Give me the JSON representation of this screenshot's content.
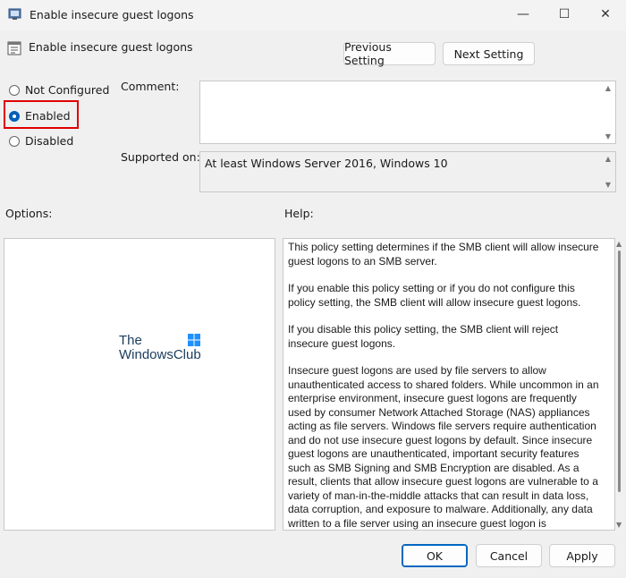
{
  "window": {
    "title": "Enable insecure guest logons",
    "heading": "Enable insecure guest logons",
    "controls": {
      "minimize": "—",
      "maximize": "☐",
      "close": "✕"
    }
  },
  "nav": {
    "previous": "Previous Setting",
    "next": "Next Setting"
  },
  "state": {
    "options": [
      {
        "label": "Not Configured",
        "checked": false
      },
      {
        "label": "Enabled",
        "checked": true
      },
      {
        "label": "Disabled",
        "checked": false
      }
    ]
  },
  "comment": {
    "label": "Comment:",
    "value": ""
  },
  "supported": {
    "label": "Supported on:",
    "value": "At least Windows Server 2016, Windows 10"
  },
  "sections": {
    "options_label": "Options:",
    "help_label": "Help:"
  },
  "logo": {
    "line1": "The",
    "line2": "WindowsClub"
  },
  "help": {
    "paragraphs": [
      "This policy setting determines if the SMB client will allow insecure guest logons to an SMB server.",
      "If you enable this policy setting or if you do not configure this policy setting, the SMB client will allow insecure guest logons.",
      "If you disable this policy setting, the SMB client will reject insecure guest logons.",
      "Insecure guest logons are used by file servers to allow unauthenticated access to shared folders. While uncommon in an enterprise environment, insecure guest logons are frequently used by consumer Network Attached Storage (NAS) appliances acting as file servers. Windows file servers require authentication and do not use insecure guest logons by default. Since insecure guest logons are unauthenticated, important security features such as SMB Signing and SMB Encryption are disabled. As a result, clients that allow insecure guest logons are vulnerable to a variety of man-in-the-middle attacks that can result in data loss, data corruption, and exposure to malware. Additionally, any data written to a file server using an insecure guest logon is"
    ]
  },
  "buttons": {
    "ok": "OK",
    "cancel": "Cancel",
    "apply": "Apply"
  },
  "colors": {
    "highlight": "#e00000",
    "accent": "#005fb8"
  }
}
